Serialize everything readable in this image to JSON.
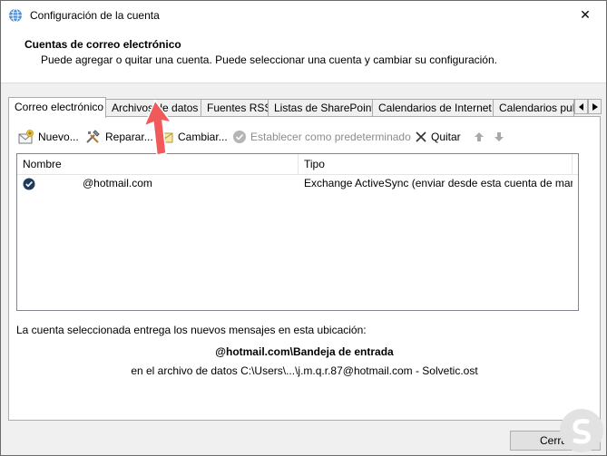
{
  "window": {
    "title": "Configuración de la cuenta",
    "close_glyph": "✕"
  },
  "header": {
    "title": "Cuentas de correo electrónico",
    "subtitle": "Puede agregar o quitar una cuenta. Puede seleccionar una cuenta y cambiar su configuración."
  },
  "tabs": [
    {
      "label": "Correo electrónico",
      "active": true
    },
    {
      "label": "Archivos de datos",
      "active": false
    },
    {
      "label": "Fuentes RSS",
      "active": false
    },
    {
      "label": "Listas de SharePoint",
      "active": false
    },
    {
      "label": "Calendarios de Internet",
      "active": false
    },
    {
      "label": "Calendarios pul",
      "active": false
    }
  ],
  "toolbar": {
    "new_label": "Nuevo...",
    "repair_label": "Reparar...",
    "change_label": "Cambiar...",
    "set_default_label": "Establecer como predeterminado",
    "remove_label": "Quitar"
  },
  "list": {
    "columns": [
      "Nombre",
      "Tipo"
    ],
    "rows": [
      {
        "name": "@hotmail.com",
        "type": "Exchange ActiveSync (enviar desde esta cuenta de mane..."
      }
    ]
  },
  "info": {
    "line1": "La cuenta seleccionada entrega los nuevos mensajes en esta ubicación:",
    "path": "@hotmail.com\\Bandeja de entrada",
    "file": "en el archivo de datos C:\\Users\\...\\j.m.q.r.87@hotmail.com - Solvetic.ost"
  },
  "footer": {
    "close_label": "Cerrar"
  },
  "colors": {
    "annotation_arrow": "#f05a5a",
    "watermark": "#d9d9d9"
  }
}
